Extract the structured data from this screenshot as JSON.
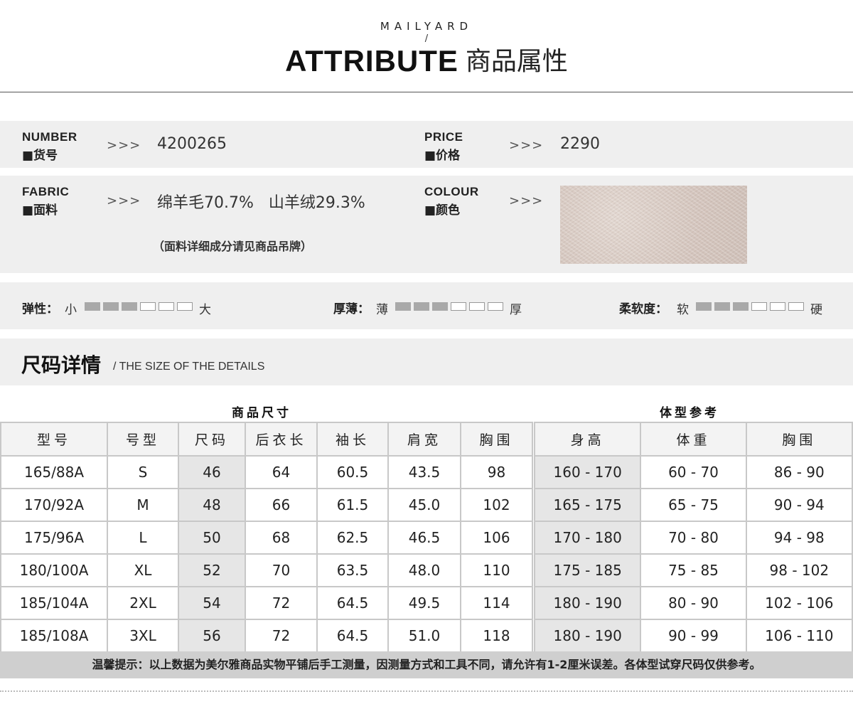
{
  "header": {
    "brand": "MAILYARD",
    "slash": "/",
    "title_en": "ATTRIBUTE",
    "title_cn": "商品属性"
  },
  "attributes": {
    "arrows": ">>>",
    "number": {
      "en": "NUMBER",
      "cn": "■货号",
      "value": "4200265"
    },
    "price": {
      "en": "PRICE",
      "cn": "■价格",
      "value": "2290"
    },
    "fabric": {
      "en": "FABRIC",
      "cn": "■面料",
      "value": "绵羊毛70.7%   山羊绒29.3%",
      "note": "（面料详细成分请见商品吊牌）"
    },
    "colour": {
      "en": "COLOUR",
      "cn": "■颜色",
      "swatch_color": "#d9ccc4"
    }
  },
  "scales": [
    {
      "label": "弹性：",
      "low": "小",
      "high": "大",
      "level": 3,
      "max": 6
    },
    {
      "label": "厚薄：",
      "low": "薄",
      "high": "厚",
      "level": 3,
      "max": 6
    },
    {
      "label": "柔软度：",
      "low": "软",
      "high": "硬",
      "level": 3,
      "max": 6
    }
  ],
  "size_section": {
    "title": "尺码详情",
    "subtitle": "/ THE SIZE OF THE DETAILS"
  },
  "product_table": {
    "caption": "商品尺寸",
    "headers": [
      "型号",
      "号型",
      "尺码",
      "后衣长",
      "袖长",
      "肩宽",
      "胸围"
    ],
    "rows": [
      [
        "165/88A",
        "S",
        "46",
        "64",
        "60.5",
        "43.5",
        "98"
      ],
      [
        "170/92A",
        "M",
        "48",
        "66",
        "61.5",
        "45.0",
        "102"
      ],
      [
        "175/96A",
        "L",
        "50",
        "68",
        "62.5",
        "46.5",
        "106"
      ],
      [
        "180/100A",
        "XL",
        "52",
        "70",
        "63.5",
        "48.0",
        "110"
      ],
      [
        "185/104A",
        "2XL",
        "54",
        "72",
        "64.5",
        "49.5",
        "114"
      ],
      [
        "185/108A",
        "3XL",
        "56",
        "72",
        "64.5",
        "51.0",
        "118"
      ]
    ]
  },
  "body_table": {
    "caption": "体型参考",
    "headers": [
      "身高",
      "体重",
      "胸围"
    ],
    "rows": [
      [
        "160 - 170",
        "60 - 70",
        "86 - 90"
      ],
      [
        "165 - 175",
        "65 - 75",
        "90 - 94"
      ],
      [
        "170 - 180",
        "70 - 80",
        "94 - 98"
      ],
      [
        "175 - 185",
        "75 - 85",
        "98 - 102"
      ],
      [
        "180 - 190",
        "80 - 90",
        "102 - 106"
      ],
      [
        "180 - 190",
        "90 - 99",
        "106 - 110"
      ]
    ]
  },
  "footer": {
    "text": "温馨提示：以上数据为美尔雅商品实物平铺后手工测量，因测量方式和工具不同，请允许有1-2厘米误差。各体型试穿尺码仅供参考。"
  }
}
